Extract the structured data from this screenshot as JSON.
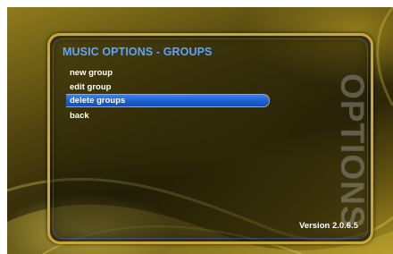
{
  "screen": {
    "title": "MUSIC OPTIONS - GROUPS",
    "menu": [
      {
        "label": "new group",
        "selected": false
      },
      {
        "label": "edit group",
        "selected": false
      },
      {
        "label": "delete groups",
        "selected": true
      },
      {
        "label": "back",
        "selected": false
      }
    ],
    "watermark": "OPTIONS",
    "version": "Version 2.0.6.5"
  },
  "colors": {
    "title": "#5ea3ff",
    "highlight": "#2a6de0",
    "frame_border": "#c9a73b",
    "background_gold": "#8f7b1c"
  }
}
